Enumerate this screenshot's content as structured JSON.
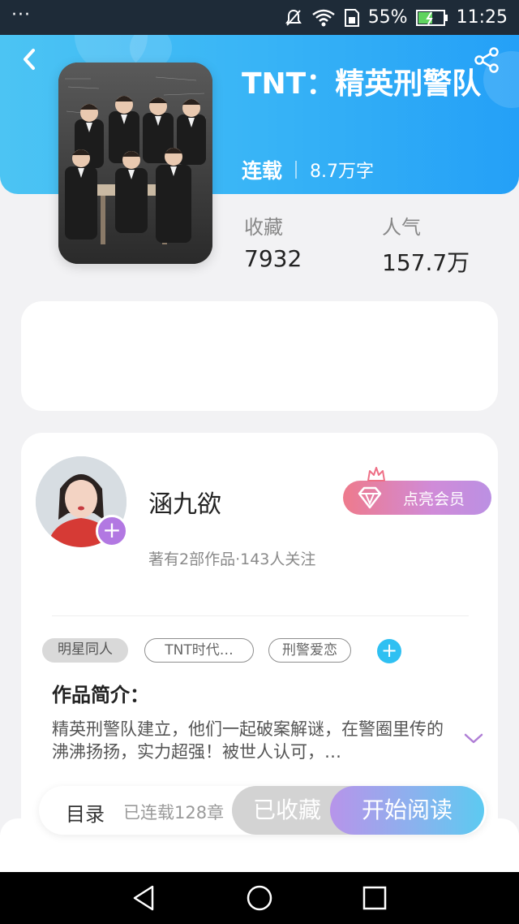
{
  "status_bar": {
    "menu_dots": "···",
    "battery_percent": "55%",
    "time": "11:25"
  },
  "book": {
    "title": "TNT：精英刑警队",
    "status": "连载",
    "word_count": "8.7万字",
    "stats": [
      {
        "label": "收藏",
        "value": "7932"
      },
      {
        "label": "人气",
        "value": "157.7万"
      }
    ]
  },
  "author": {
    "name": "涵九欲",
    "info": "著有2部作品·143人关注",
    "vip_label": "点亮会员"
  },
  "tags": [
    "明星同人",
    "TNT时代…",
    "刑警爱恋"
  ],
  "intro": {
    "title": "作品简介：",
    "text": "精英刑警队建立，他们一起破案解谜，在警圈里传的沸沸扬扬，实力超强！被世人认可，…"
  },
  "actions": {
    "toc": "目录",
    "progress": "已连载128章",
    "collected": "已收藏",
    "read": "开始阅读"
  },
  "colors": {
    "header_start": "#4cc4f3",
    "header_end": "#24a0f7",
    "vip_start": "#ee7a8c",
    "vip_end": "#bb90e3",
    "accent_purple": "#b278e2",
    "accent_blue": "#2fc0f2"
  },
  "icons": {
    "back": "back-arrow-icon",
    "share": "share-icon",
    "follow": "plus-icon",
    "vip": "diamond-icon",
    "crown": "crown-icon",
    "expand": "chevron-down-icon",
    "nav_back": "triangle-back-icon",
    "nav_home": "circle-home-icon",
    "nav_recent": "square-recent-icon"
  }
}
